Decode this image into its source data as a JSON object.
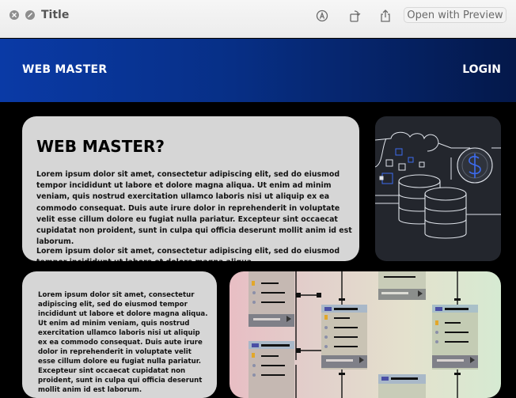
{
  "window": {
    "title": "Title",
    "open_with_label": "Open with Preview"
  },
  "nav": {
    "brand": "WEB MASTER",
    "login": "LOGIN"
  },
  "hero": {
    "heading": "WEB MASTER?",
    "paragraph1": "Lorem ipsum dolor sit amet, consectetur adipiscing elit, sed do eiusmod tempor incididunt ut labore et dolore magna aliqua. Ut enim ad minim veniam, quis nostrud exercitation ullamco laboris nisi ut aliquip ex ea commodo consequat. Duis aute irure dolor in reprehenderit in voluptate velit esse cillum dolore eu fugiat nulla pariatur. Excepteur sint occaecat cupidatat non proident, sunt in culpa qui officia deserunt mollit anim id est laborum.",
    "paragraph2": "Lorem ipsum dolor sit amet, consectetur adipiscing elit, sed do eiusmod tempor incididunt ut labore et dolore magna aliqua."
  },
  "second_card": {
    "paragraph": "Lorem ipsum dolor sit amet, consectetur adipiscing elit, sed do eiusmod tempor incididunt ut labore et dolore magna aliqua. Ut enim ad minim veniam, quis nostrud exercitation ullamco laboris nisi ut aliquip ex ea commodo consequat. Duis aute irure dolor in reprehenderit in voluptate velit esse cillum dolore eu fugiat nulla pariatur. Excepteur sint occaecat cupidatat non proident, sunt in culpa qui officia deserunt mollit anim id est laborum."
  },
  "icons": {
    "close": "close-icon",
    "minimize": "minimize-icon",
    "markup": "markup-pen-icon",
    "rotate": "rotate-icon",
    "share": "share-icon",
    "dollar": "dollar-coin-icon",
    "database": "database-icon",
    "cloud": "cloud-icon"
  },
  "colors": {
    "nav_start": "#0a3aa6",
    "nav_end": "#04184a",
    "card_bg": "#d6d6d6",
    "illustration_bg": "#23262d",
    "accent_blue": "#3d6cf0"
  }
}
